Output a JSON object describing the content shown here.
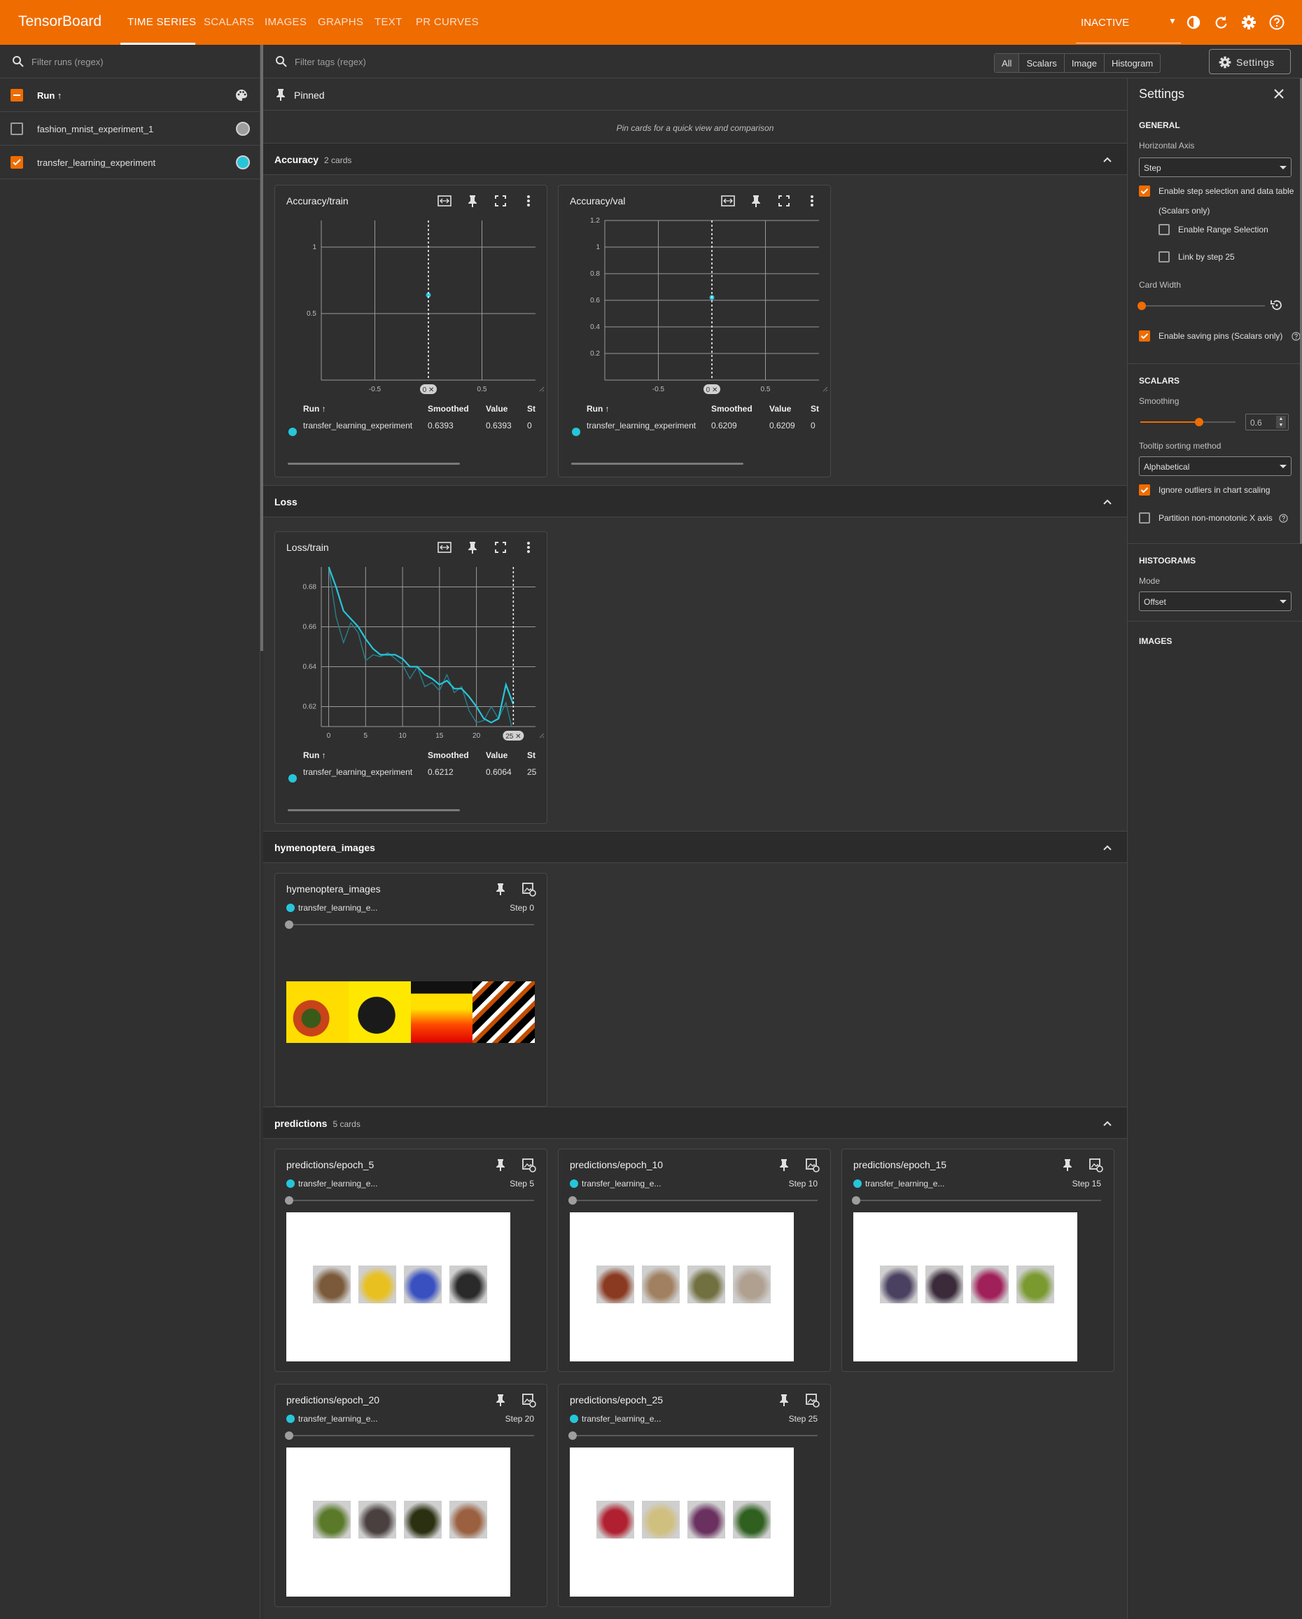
{
  "topbar": {
    "brand": "TensorBoard",
    "tabs": [
      "TIME SERIES",
      "SCALARS",
      "IMAGES",
      "GRAPHS",
      "TEXT",
      "PR CURVES"
    ],
    "active_tab": "TIME SERIES",
    "status_select": "INACTIVE",
    "icons": [
      "theme-icon",
      "refresh-icon",
      "settings-gear-icon",
      "help-icon"
    ],
    "accent_color": "#ef6c00"
  },
  "sidebar": {
    "filter_placeholder": "Filter runs (regex)",
    "header_label": "Run ↑",
    "runs": [
      {
        "name": "fashion_mnist_experiment_1",
        "checked": false,
        "color": "#9e9e9e"
      },
      {
        "name": "transfer_learning_experiment",
        "checked": true,
        "color": "#26c6da"
      }
    ]
  },
  "tag_bar": {
    "filter_placeholder": "Filter tags (regex)",
    "type_filters": [
      "All",
      "Scalars",
      "Image",
      "Histogram"
    ],
    "settings_label": "Settings"
  },
  "pinned": {
    "label": "Pinned",
    "empty_message": "Pin cards for a quick view and comparison"
  },
  "groups": {
    "accuracy": {
      "name": "Accuracy",
      "count": "2 cards"
    },
    "loss": {
      "name": "Loss",
      "count": ""
    },
    "hymenoptera": {
      "name": "hymenoptera_images",
      "count": ""
    },
    "predictions": {
      "name": "predictions",
      "count": "5 cards"
    }
  },
  "scalar_table_headers": {
    "run": "Run ↑",
    "smoothed": "Smoothed",
    "value": "Value",
    "step": "St"
  },
  "scalar_cards": [
    {
      "title": "Accuracy/train",
      "run": "transfer_learning_experiment",
      "smoothed": "0.6393",
      "value": "0.6393",
      "step": "0",
      "step_marker": "0",
      "y_ticks": [
        "1",
        "0.5"
      ],
      "x_ticks": [
        "-0.5",
        "0.5"
      ]
    },
    {
      "title": "Accuracy/val",
      "run": "transfer_learning_experiment",
      "smoothed": "0.6209",
      "value": "0.6209",
      "step": "0",
      "step_marker": "0",
      "y_ticks": [
        "1.2",
        "1",
        "0.8",
        "0.6",
        "0.4",
        "0.2"
      ],
      "x_ticks": [
        "-0.5",
        "0.5"
      ]
    },
    {
      "title": "Loss/train",
      "run": "transfer_learning_experiment",
      "smoothed": "0.6212",
      "value": "0.6064",
      "step": "25",
      "step_marker": "25",
      "y_ticks": [
        "0.68",
        "0.66",
        "0.64",
        "0.62"
      ],
      "x_ticks": [
        "0",
        "5",
        "10",
        "15",
        "20"
      ]
    }
  ],
  "chart_data": [
    {
      "type": "scatter",
      "title": "Accuracy/train",
      "x": [
        0
      ],
      "y": [
        0.6393
      ],
      "xlim": [
        -1,
        1
      ],
      "ylim": [
        0,
        1.2
      ],
      "series": [
        {
          "name": "transfer_learning_experiment",
          "values": [
            0.6393
          ]
        }
      ],
      "grid": true
    },
    {
      "type": "scatter",
      "title": "Accuracy/val",
      "x": [
        0
      ],
      "y": [
        0.6209
      ],
      "xlim": [
        -1,
        1
      ],
      "ylim": [
        0,
        1.2
      ],
      "series": [
        {
          "name": "transfer_learning_experiment",
          "values": [
            0.6209
          ]
        }
      ],
      "grid": true
    },
    {
      "type": "line",
      "title": "Loss/train",
      "x": [
        0,
        1,
        2,
        3,
        4,
        5,
        6,
        7,
        8,
        9,
        10,
        11,
        12,
        13,
        14,
        15,
        16,
        17,
        18,
        19,
        20,
        21,
        22,
        23,
        24,
        25
      ],
      "series": [
        {
          "name": "transfer_learning_experiment",
          "values": [
            0.69,
            0.665,
            0.652,
            0.662,
            0.657,
            0.643,
            0.646,
            0.645,
            0.647,
            0.644,
            0.641,
            0.634,
            0.64,
            0.63,
            0.632,
            0.628,
            0.636,
            0.627,
            0.63,
            0.618,
            0.612,
            0.613,
            0.62,
            0.614,
            0.622,
            0.6064
          ]
        },
        {
          "name": "smoothed",
          "values": [
            0.69,
            0.68,
            0.668,
            0.664,
            0.66,
            0.654,
            0.649,
            0.646,
            0.646,
            0.646,
            0.644,
            0.64,
            0.64,
            0.636,
            0.634,
            0.631,
            0.633,
            0.629,
            0.629,
            0.625,
            0.62,
            0.614,
            0.612,
            0.614,
            0.631,
            0.6212
          ]
        }
      ],
      "xlim": [
        -1,
        28
      ],
      "ylim": [
        0.61,
        0.69
      ],
      "grid": true
    }
  ],
  "image_cards": [
    {
      "title": "hymenoptera_images",
      "run": "transfer_learning_e...",
      "step": "Step 0"
    },
    {
      "title": "predictions/epoch_5",
      "run": "transfer_learning_e...",
      "step": "Step 5"
    },
    {
      "title": "predictions/epoch_10",
      "run": "transfer_learning_e...",
      "step": "Step 10"
    },
    {
      "title": "predictions/epoch_15",
      "run": "transfer_learning_e...",
      "step": "Step 15"
    },
    {
      "title": "predictions/epoch_20",
      "run": "transfer_learning_e...",
      "step": "Step 20"
    },
    {
      "title": "predictions/epoch_25",
      "run": "transfer_learning_e...",
      "step": "Step 25"
    }
  ],
  "settings_panel": {
    "title": "Settings",
    "general": {
      "heading": "GENERAL",
      "horizontal_axis_label": "Horizontal Axis",
      "horizontal_axis_value": "Step",
      "step_selection_label": "Enable step selection and data table",
      "step_selection_sub": "(Scalars only)",
      "step_selection_checked": true,
      "range_selection_label": "Enable Range Selection",
      "range_selection_checked": false,
      "link_step_label": "Link by step 25",
      "link_step_checked": false,
      "card_width_label": "Card Width",
      "saving_pins_label": "Enable saving pins (Scalars only)",
      "saving_pins_checked": true
    },
    "scalars": {
      "heading": "SCALARS",
      "smoothing_label": "Smoothing",
      "smoothing_value": "0.6",
      "tooltip_sort_label": "Tooltip sorting method",
      "tooltip_sort_value": "Alphabetical",
      "ignore_outliers_label": "Ignore outliers in chart scaling",
      "ignore_outliers_checked": true,
      "partition_label": "Partition non-monotonic X axis",
      "partition_checked": false
    },
    "histograms": {
      "heading": "HISTOGRAMS",
      "mode_label": "Mode",
      "mode_value": "Offset"
    },
    "images": {
      "heading": "IMAGES"
    }
  }
}
